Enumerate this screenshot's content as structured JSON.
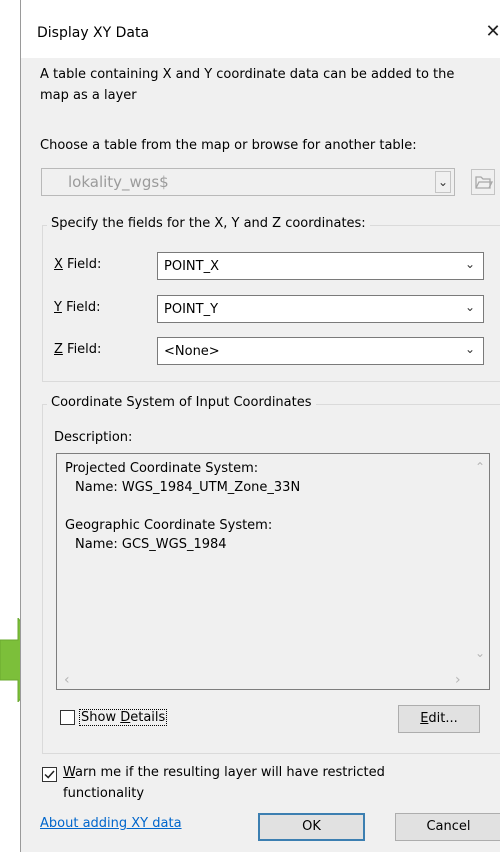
{
  "window": {
    "title": "Display XY Data",
    "close_glyph": "✕"
  },
  "intro": {
    "line1": "A table containing X and Y coordinate data can be added to the",
    "line2": "map as a layer"
  },
  "table_select": {
    "prompt": "Choose a table from the map or browse for another table:",
    "value": "lokality_wgs$",
    "browse_icon": "open-folder-icon"
  },
  "fields_group": {
    "title": "Specify the fields for the X, Y and Z coordinates:",
    "x": {
      "label_key": "X",
      "label_rest": " Field:",
      "value": "POINT_X"
    },
    "y": {
      "label_key": "Y",
      "label_rest": " Field:",
      "value": "POINT_Y"
    },
    "z": {
      "label_key": "Z",
      "label_rest": " Field:",
      "value": "<None>"
    }
  },
  "coord_group": {
    "title": "Coordinate System of Input Coordinates",
    "description_label": "Description:",
    "description_lines": [
      "Projected Coordinate System:",
      "  Name: WGS_1984_UTM_Zone_33N",
      "",
      "Geographic Coordinate System:",
      "  Name: GCS_WGS_1984"
    ],
    "show_details": {
      "label_pre": "Show ",
      "label_key": "D",
      "label_post": "etails",
      "checked": false
    },
    "edit_button": {
      "label_key": "E",
      "label_rest": "dit..."
    }
  },
  "warn": {
    "checked": true,
    "line1_key": "W",
    "line1_rest": "arn me if the resulting layer will have restricted",
    "line2": "functionality"
  },
  "footer": {
    "link": "About adding XY data",
    "ok": "OK",
    "cancel": "Cancel"
  },
  "colors": {
    "dialog_bg": "#f0f0f0",
    "default_button_border": "#3c7fb1",
    "link": "#0066cc",
    "annotation_arrow": "#7cbf3a"
  }
}
